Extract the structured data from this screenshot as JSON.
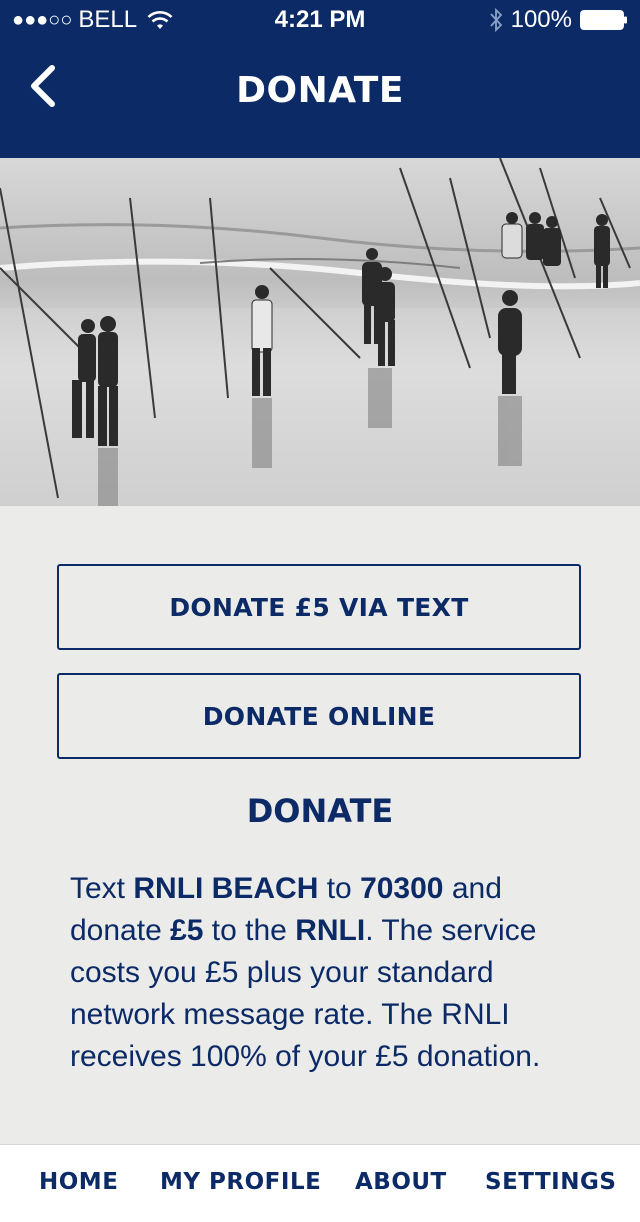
{
  "status_bar": {
    "signal": "●●●○○",
    "carrier": "BELL",
    "time": "4:21 PM",
    "battery": "100%"
  },
  "header": {
    "title": "DONATE"
  },
  "buttons": {
    "donate_text": "DONATE £5 VIA TEXT",
    "donate_online": "DONATE ONLINE"
  },
  "section": {
    "heading": "DONATE",
    "body_parts": [
      "Text ",
      "RNLI BEACH",
      " to ",
      "70300",
      " and donate ",
      "£5",
      " to the ",
      "RNLI",
      ". The service costs you £5 plus your standard network message rate. The RNLI receives 100% of your £5 donation."
    ]
  },
  "tabs": {
    "home": "HOME",
    "profile": "MY PROFILE",
    "about": "ABOUT",
    "settings": "SETTINGS"
  },
  "colors": {
    "primary": "#0b2a66",
    "background": "#ebebea",
    "tab_bar": "#ffffff"
  },
  "icons": {
    "back": "chevron-left-icon",
    "wifi": "wifi-icon",
    "bluetooth": "bluetooth-icon",
    "battery": "battery-icon"
  }
}
